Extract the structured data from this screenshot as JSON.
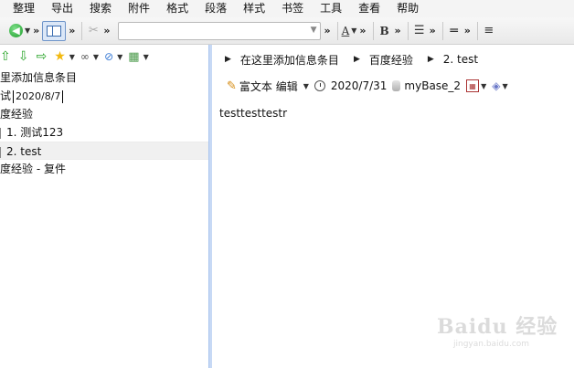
{
  "menu": [
    "整理",
    "导出",
    "搜索",
    "附件",
    "格式",
    "段落",
    "样式",
    "书签",
    "工具",
    "查看",
    "帮助"
  ],
  "toolbar": {
    "nav_back_icon": "green-circle-back",
    "font_color_label": "A",
    "bold_label": "B",
    "more": "»",
    "combo_value": ""
  },
  "tree": {
    "rows": [
      {
        "text": "里添加信息条目"
      },
      {
        "text": "试",
        "date": "2020/8/7"
      },
      {
        "text": "度经验"
      },
      {
        "text": "1.  测试123"
      },
      {
        "text": "2.  test"
      },
      {
        "text": "度经验 - 复件"
      }
    ]
  },
  "breadcrumb": [
    "在这里添加信息条目",
    "百度经验",
    "2.  test"
  ],
  "info": {
    "editor_label": "富文本 编辑",
    "date": "2020/7/31",
    "database": "myBase_2"
  },
  "content": {
    "text": "testtesttestr"
  },
  "watermark": {
    "brand": "Baidu 经验",
    "url": "jingyan.baidu.com"
  }
}
